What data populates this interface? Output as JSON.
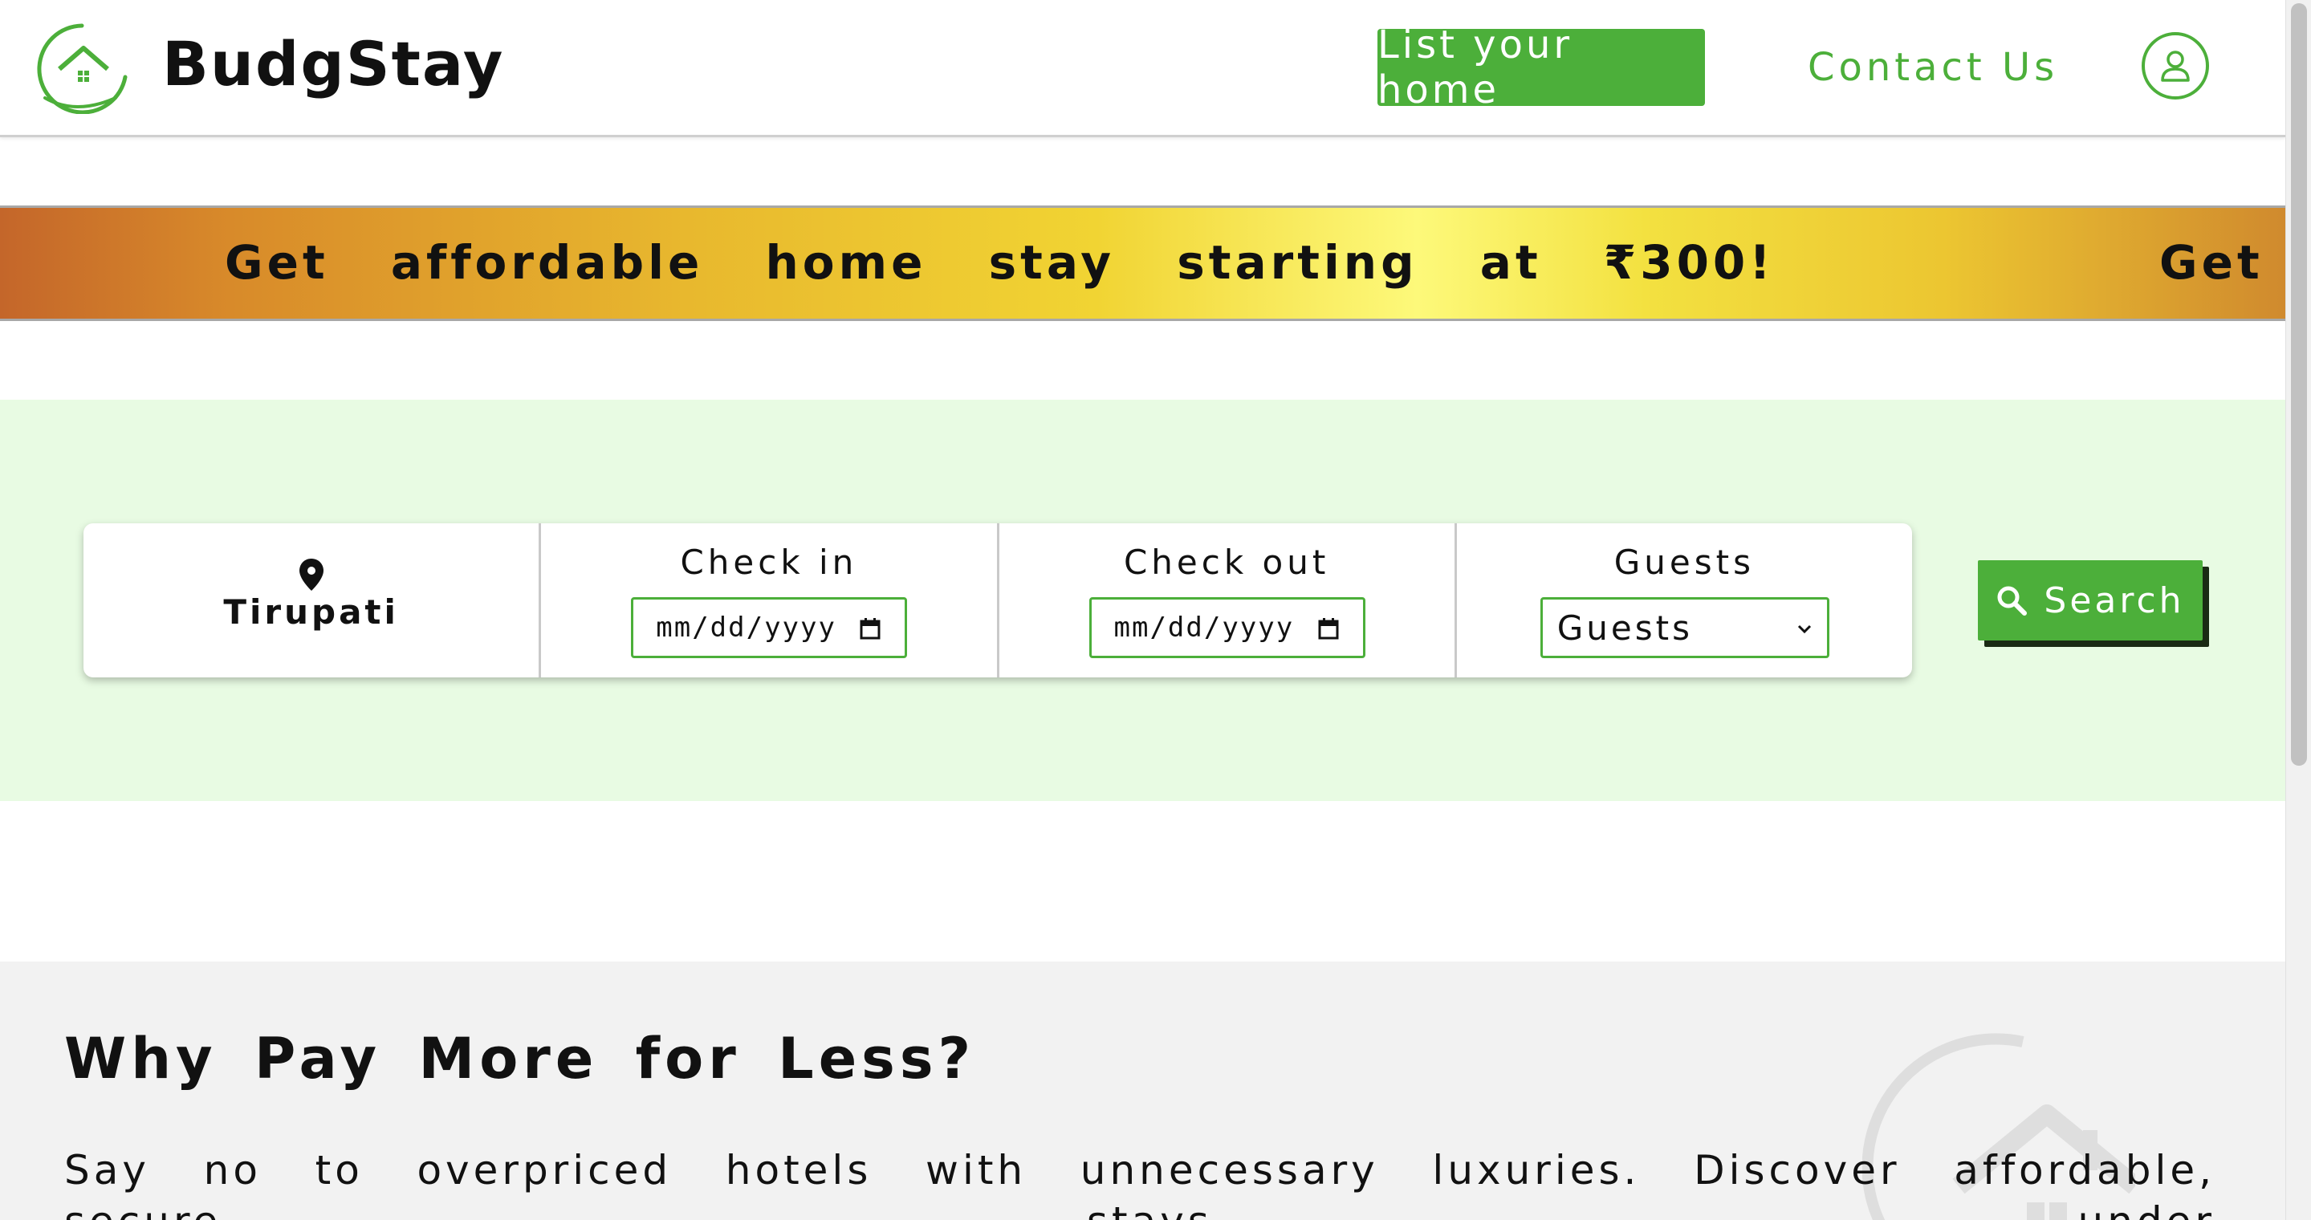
{
  "header": {
    "brand": "BudgStay",
    "list_home_label": "List your home",
    "contact_label": "Contact Us",
    "logo_icon": "house-swoosh-logo",
    "user_icon": "user-icon"
  },
  "banner": {
    "text": "Get affordable home stay starting at ₹300!",
    "repeat_text": "Get"
  },
  "search": {
    "location": "Tirupati",
    "location_icon": "map-pin-icon",
    "check_in_label": "Check in",
    "check_in_placeholder": "mm/dd/yyyy",
    "check_out_label": "Check out",
    "check_out_placeholder": "mm/dd/yyyy",
    "guests_label": "Guests",
    "guests_selected": "Guests",
    "search_label": "Search"
  },
  "why": {
    "title": "Why Pay More for Less?",
    "text": "Say no to overpriced hotels with unnecessary luxuries. Discover affordable, secure stays under"
  },
  "colors": {
    "brand_green": "#4caf3a",
    "search_bg": "#e8fbe3",
    "why_bg": "#f2f2f2"
  }
}
